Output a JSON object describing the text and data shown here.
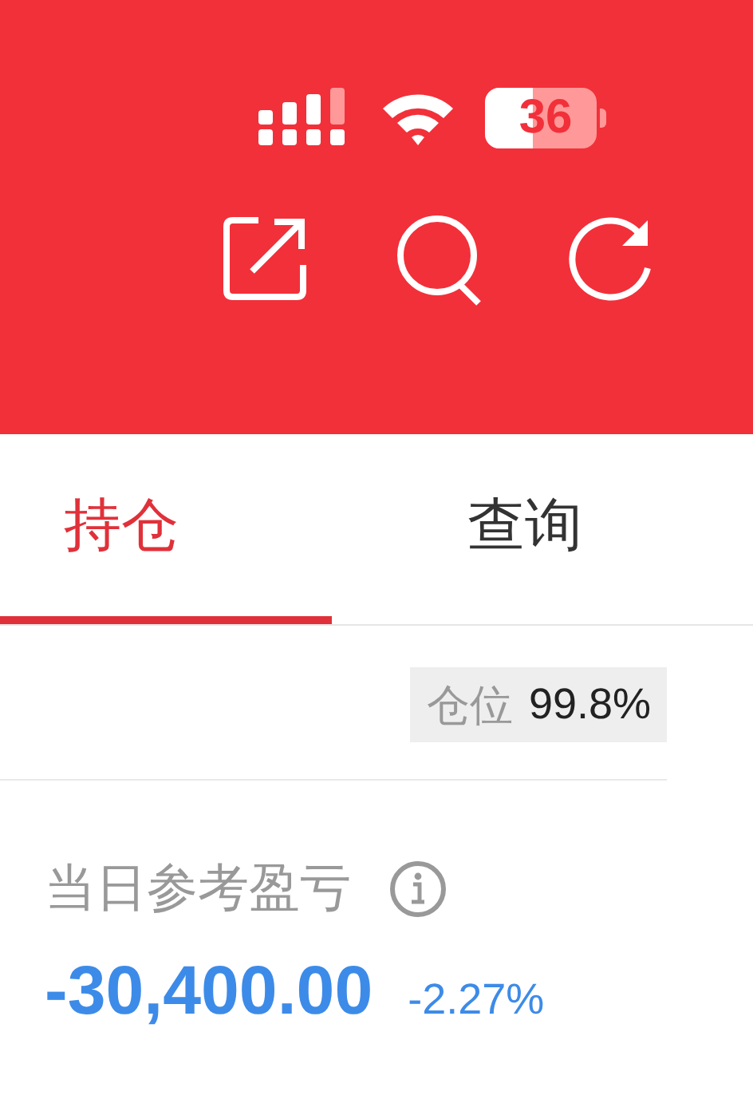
{
  "status_bar": {
    "battery": "36"
  },
  "toolbar": {
    "actions": [
      {
        "kind": "share"
      },
      {
        "kind": "search"
      },
      {
        "kind": "refresh"
      }
    ]
  },
  "tabs": [
    {
      "label": "持仓",
      "selected": true
    },
    {
      "label": "查询",
      "selected": false
    }
  ],
  "position": {
    "label": "仓位",
    "value": "99.8%"
  },
  "daily_pnl": {
    "label": "当日参考盈亏",
    "amount": "-30,400.00",
    "percent": "-2.27%"
  }
}
